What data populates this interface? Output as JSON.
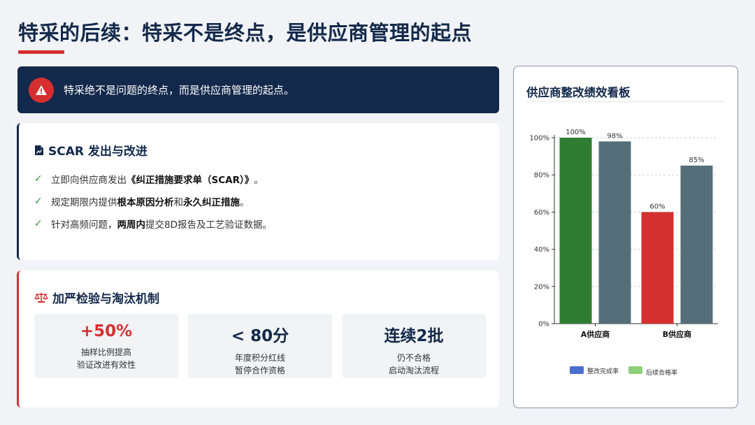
{
  "title": "特采的后续：特采不是终点，是供应商管理的起点",
  "alert": {
    "text": "特采绝不是问题的终点，而是供应商管理的起点。"
  },
  "scar": {
    "heading": "SCAR 发出与改进",
    "items": [
      {
        "pre": "立即向供应商发出",
        "b1": "《纠正措施要求单（SCAR）》",
        "mid": "",
        "b2": "",
        "post": "。"
      },
      {
        "pre": "规定期限内提供",
        "b1": "根本原因分析",
        "mid": "和",
        "b2": "永久纠正措施",
        "post": "。"
      },
      {
        "pre": "针对高频问题，",
        "b1": "两周内",
        "mid": "提交8D报告及工艺验证数据。",
        "b2": "",
        "post": ""
      }
    ]
  },
  "strict": {
    "heading": "加严检验与淘汰机制",
    "stats": [
      {
        "value": "+50%",
        "line1": "抽样比例提高",
        "line2": "验证改进有效性"
      },
      {
        "value": "< 80分",
        "line1": "年度积分红线",
        "line2": "暂停合作资格"
      },
      {
        "value": "连续2批",
        "line1": "仍不合格",
        "line2": "启动淘汰流程"
      }
    ]
  },
  "panel": {
    "title": "供应商整改绩效看板"
  },
  "colors": {
    "navy": "#13294b",
    "red": "#d62f2f",
    "green": "#2e7d32",
    "slate": "#546e7a",
    "legend_blue": "#4a6fd1",
    "legend_green": "#8ed07a"
  },
  "chart_data": {
    "type": "bar",
    "categories": [
      "A供应商",
      "B供应商"
    ],
    "series": [
      {
        "name": "整改完成率",
        "values": [
          100,
          60
        ]
      },
      {
        "name": "后续合格率",
        "values": [
          98,
          85
        ]
      }
    ],
    "data_labels": [
      [
        "100%",
        "60%"
      ],
      [
        "98%",
        "85%"
      ]
    ],
    "bar_colors": [
      [
        "#2e7d32",
        "#d62f2f"
      ],
      [
        "#546e7a",
        "#546e7a"
      ]
    ],
    "legend_colors": [
      "#4a6fd1",
      "#8ed07a"
    ],
    "ylim": [
      0,
      100
    ],
    "yticks": [
      "0%",
      "20%",
      "40%",
      "60%",
      "80%",
      "100%"
    ],
    "ytick_values": [
      0,
      20,
      40,
      60,
      80,
      100
    ],
    "grid": true,
    "legend": "bottom"
  }
}
